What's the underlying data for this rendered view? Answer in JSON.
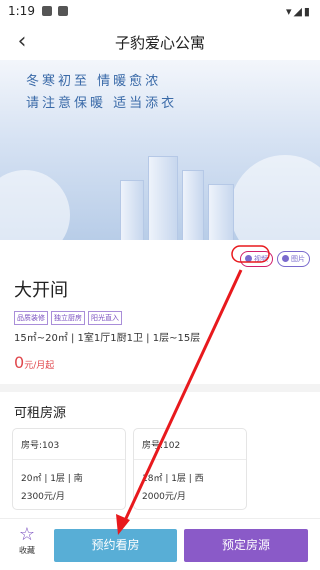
{
  "status_bar": {
    "time": "1:19"
  },
  "nav": {
    "title": "子豹爱心公寓"
  },
  "banner": {
    "line1": "冬寒初至 情暖愈浓",
    "line2": "请注意保暖 适当添衣"
  },
  "media_tabs": {
    "video": "视频",
    "photo": "图片"
  },
  "room": {
    "name": "大开间",
    "tags": [
      "品质装修",
      "独立厨房",
      "阳光直入"
    ],
    "spec": "15㎡~20㎡ | 1室1厅1厨1卫 | 1层~15层",
    "price_num": "0",
    "price_unit": "元/月起"
  },
  "rentable": {
    "title": "可租房源",
    "cards": [
      {
        "no": "房号:103",
        "info": "20㎡ | 1层 | 南",
        "price": "2300元/月"
      },
      {
        "no": "房号:102",
        "info": "18㎡ | 1层 | 西",
        "price": "2000元/月"
      }
    ]
  },
  "bottom": {
    "fav_label": "收藏",
    "visit_label": "预约看房",
    "reserve_label": "预定房源"
  },
  "colors": {
    "accent_purple": "#8a5ac8",
    "accent_blue": "#58aed6",
    "price_red": "#e0474c",
    "annotation_arrow": "#e8191d"
  },
  "icons": {
    "back": "back-arrow-icon",
    "fav": "star-outline-icon"
  }
}
